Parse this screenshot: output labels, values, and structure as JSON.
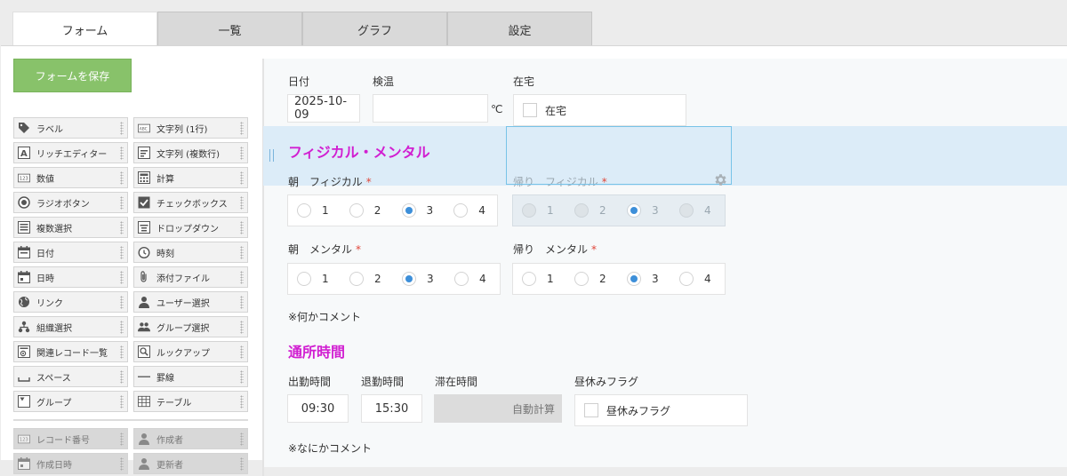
{
  "tabs": [
    "フォーム",
    "一覧",
    "グラフ",
    "設定"
  ],
  "palette": {
    "save_label": "フォームを保存",
    "items": [
      {
        "label": "ラベル",
        "icon": "tag-icon"
      },
      {
        "label": "文字列 (1行)",
        "icon": "text-single-icon"
      },
      {
        "label": "リッチエディター",
        "icon": "rich-editor-icon"
      },
      {
        "label": "文字列 (複数行)",
        "icon": "text-multi-icon"
      },
      {
        "label": "数値",
        "icon": "number-icon"
      },
      {
        "label": "計算",
        "icon": "calculator-icon"
      },
      {
        "label": "ラジオボタン",
        "icon": "radio-icon"
      },
      {
        "label": "チェックボックス",
        "icon": "checkbox-icon"
      },
      {
        "label": "複数選択",
        "icon": "multiselect-icon"
      },
      {
        "label": "ドロップダウン",
        "icon": "dropdown-icon"
      },
      {
        "label": "日付",
        "icon": "calendar-icon"
      },
      {
        "label": "時刻",
        "icon": "clock-icon"
      },
      {
        "label": "日時",
        "icon": "datetime-icon"
      },
      {
        "label": "添付ファイル",
        "icon": "paperclip-icon"
      },
      {
        "label": "リンク",
        "icon": "globe-icon"
      },
      {
        "label": "ユーザー選択",
        "icon": "user-icon"
      },
      {
        "label": "組織選択",
        "icon": "org-icon"
      },
      {
        "label": "グループ選択",
        "icon": "group-icon"
      },
      {
        "label": "関連レコード一覧",
        "icon": "related-records-icon"
      },
      {
        "label": "ルックアップ",
        "icon": "lookup-icon"
      },
      {
        "label": "スペース",
        "icon": "space-icon"
      },
      {
        "label": "罫線",
        "icon": "line-icon"
      },
      {
        "label": "グループ",
        "icon": "group-box-icon"
      },
      {
        "label": "テーブル",
        "icon": "table-icon"
      }
    ],
    "system_items": [
      {
        "label": "レコード番号",
        "icon": "number-icon"
      },
      {
        "label": "作成者",
        "icon": "user-icon"
      },
      {
        "label": "作成日時",
        "icon": "datetime-icon"
      },
      {
        "label": "更新者",
        "icon": "user-icon"
      }
    ]
  },
  "form": {
    "date_label": "日付",
    "date_value": "2025-10-09",
    "temp_label": "検温",
    "temp_value": "",
    "temp_unit": "℃",
    "home_label": "在宅",
    "home_checkbox_label": "在宅",
    "section1_title": "フィジカル・メンタル",
    "morning_physical_label": "朝　フィジカル",
    "evening_physical_label": "帰り　フィジカル",
    "morning_mental_label": "朝　メンタル",
    "evening_mental_label": "帰り　メンタル",
    "radio_options": [
      "1",
      "2",
      "3",
      "4"
    ],
    "selected_option": "3",
    "required_mark": "*",
    "comment1": "※何かコメント",
    "section2_title": "通所時間",
    "start_label": "出勤時間",
    "start_value": "09:30",
    "end_label": "退勤時間",
    "end_value": "15:30",
    "stay_label": "滞在時間",
    "stay_value": "自動計算",
    "lunch_label": "昼休みフラグ",
    "lunch_checkbox_label": "昼休みフラグ",
    "comment2": "※なにかコメント"
  },
  "colors": {
    "accent_green": "#88c26a",
    "section_title": "#d11fd1",
    "radio_selected": "#3d8fd9",
    "highlight_row": "#dcecf8"
  }
}
